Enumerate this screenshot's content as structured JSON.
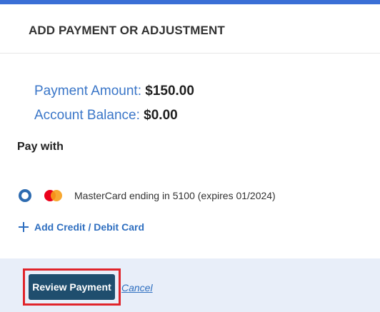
{
  "colors": {
    "accent": "#3a6fd6",
    "label_blue": "#3a76c8",
    "link_blue": "#2f6fc0",
    "button_bg": "#1f4e6e",
    "highlight_red": "#e0242b",
    "footer_bg": "#e8eef9"
  },
  "header": {
    "title": "ADD PAYMENT OR ADJUSTMENT"
  },
  "summary": {
    "payment_amount_label": "Payment Amount:",
    "payment_amount_value": "$150.00",
    "account_balance_label": "Account Balance:",
    "account_balance_value": "$0.00"
  },
  "pay_with": {
    "label": "Pay with",
    "cards": [
      {
        "icon": "mastercard-icon",
        "label": "MasterCard ending in 5100 (expires 01/2024)",
        "selected": true
      }
    ],
    "add_card_label": "Add Credit / Debit Card"
  },
  "footer": {
    "review_label": "Review Payment",
    "cancel_label": "Cancel"
  }
}
